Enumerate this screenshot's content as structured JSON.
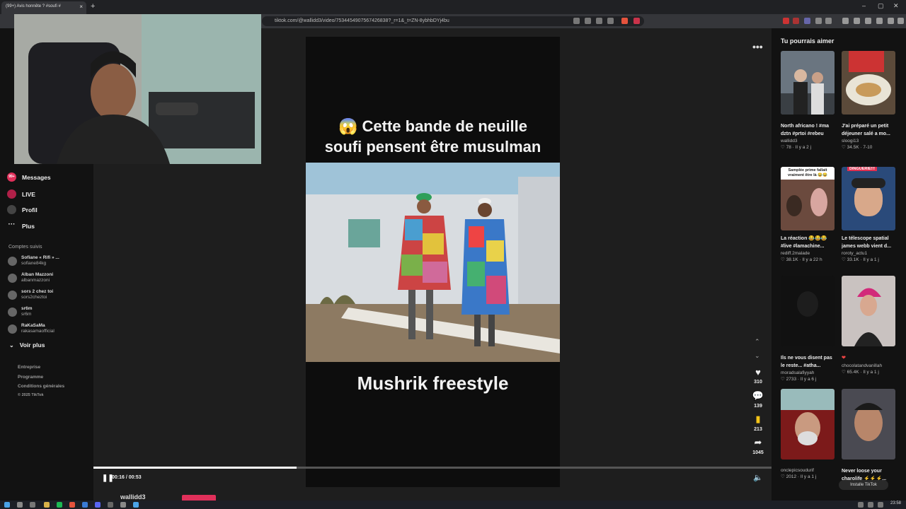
{
  "browser": {
    "tab_title": "(99+) Avis honnête ? #soufi #",
    "tab_close": "×",
    "new_tab": "+",
    "url": "tiktok.com/@wallidd3/video/7534454907567426838?_r=1&_t=ZN-8ybhbDYj4bu",
    "win_min": "–",
    "win_max": "▢",
    "win_close": "✕"
  },
  "nav": {
    "messages_badge": "99+",
    "messages": "Messages",
    "live": "LIVE",
    "profile": "Profil",
    "more": "Plus",
    "followed_label": "Comptes suivis",
    "followed": [
      {
        "name": "Sofiane « Rifi » ...",
        "handle": "sofiane84kg"
      },
      {
        "name": "Alban Mazzoni",
        "handle": "albanmazzoni"
      },
      {
        "name": "sors 2 chez toi",
        "handle": "sors2cheztoi"
      },
      {
        "name": "sr6m",
        "handle": "sr6m"
      },
      {
        "name": "RaKaSaMa",
        "handle": "rakasamaofficial"
      }
    ],
    "see_more": "Voir plus",
    "footer": [
      "Entreprise",
      "Programme",
      "Conditions générales",
      "© 2025 TikTok"
    ]
  },
  "video": {
    "top_text_line1": "😱 Cette bande de neuille",
    "top_text_line2": "soufi pensent être musulman",
    "bottom_text": "Mushrik freestyle",
    "time": "00:16 / 00:53",
    "progress": 0.3,
    "author": "wallidd3",
    "more": "•••"
  },
  "actions": {
    "likes": "310",
    "comments": "139",
    "saves": "213",
    "shares": "1045"
  },
  "right": {
    "title": "Tu pourrais aimer",
    "cards": [
      {
        "caption": "North africano ! #ma dztn #prtoi #rebeu",
        "author": "wallidd3",
        "stats": "♡ 78 · Il y a 2 j"
      },
      {
        "caption": "J'ai préparé un petit déjeuner salé a mo...",
        "author": "sloogi13",
        "stats": "♡ 34.5K · 7-10"
      },
      {
        "caption": "La réaction 😂😂😂 #live #lamachine...",
        "author": "rediff.2malade",
        "stats": "♡ 38.1K · Il y a 22 h",
        "thumb_text": "Samplée prime fallait vraiment être là 😂😂"
      },
      {
        "caption": "Le télescope spatial james webb vient d...",
        "author": "roroty_actu1",
        "stats": "♡ 33.1K · Il y a 1 j",
        "thumb_text": "DINGUERIE!!!"
      },
      {
        "caption": "Ils ne vous disent pas le reste... #atha...",
        "author": "moradsalafiyyah",
        "stats": "♡ 2733 · Il y a 6 j"
      },
      {
        "caption": "❤",
        "author": "chocolatandvanillah",
        "stats": "♡ 65.4K · Il y a 1 j"
      },
      {
        "caption": "",
        "author": "onclepicsoudurif",
        "stats": "♡ 2012 · Il y a 1 j"
      },
      {
        "caption": "Never loose your charolife ⚡⚡⚡...",
        "author": "",
        "stats": ""
      }
    ],
    "install": "Installe TikTok"
  },
  "taskbar": {
    "clock": "23:58"
  }
}
